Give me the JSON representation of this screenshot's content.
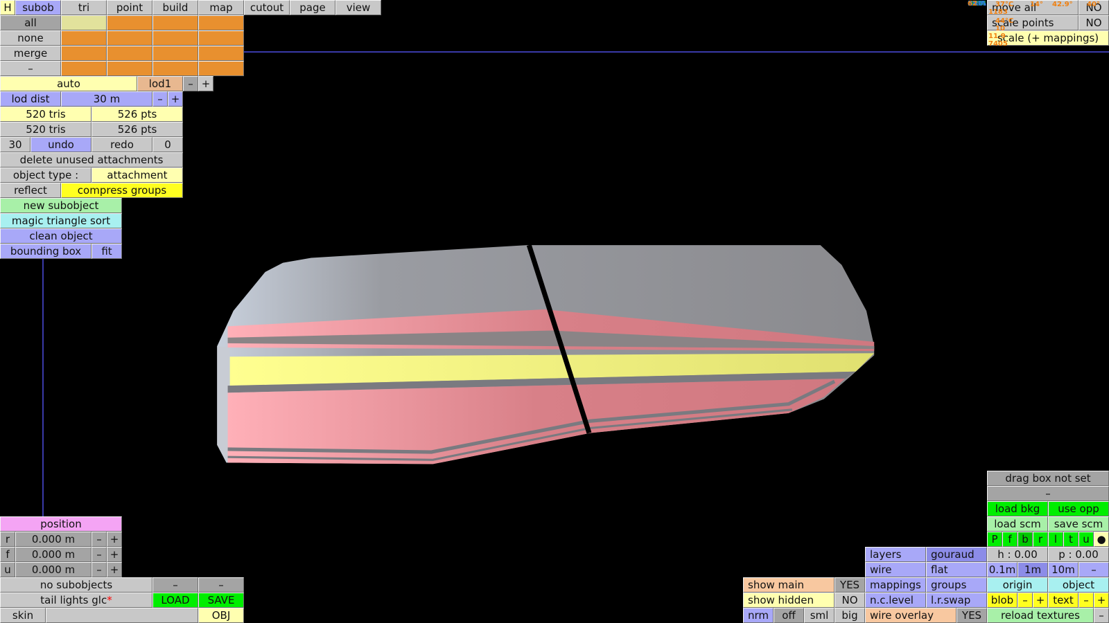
{
  "menu": {
    "h": "H",
    "tabs": [
      "subob",
      "tri",
      "point",
      "build",
      "map",
      "cutout",
      "page",
      "view"
    ]
  },
  "grid": {
    "rows": [
      "all",
      "none",
      "merge",
      "–"
    ]
  },
  "lod": {
    "auto": "auto",
    "level": "lod1",
    "minus": "–",
    "plus": "+",
    "dist_label": "lod dist",
    "dist_value": "30 m"
  },
  "stats": {
    "tris1": "520 tris",
    "pts1": "526 pts",
    "tris2": "520 tris",
    "pts2": "526 pts"
  },
  "undo": {
    "count": "30",
    "undo": "undo",
    "redo": "redo",
    "redo_count": "0"
  },
  "actions": {
    "delete_unused": "delete unused attachments",
    "object_type_label": "object type :",
    "object_type": "attachment",
    "reflect": "reflect",
    "compress": "compress groups",
    "new_subobject": "new subobject",
    "magic_sort": "magic triangle sort",
    "clean": "clean object",
    "bbox": "bounding box",
    "fit": "fit"
  },
  "position": {
    "title": "position",
    "axes": [
      {
        "axis": "r",
        "value": "0.000 m"
      },
      {
        "axis": "f",
        "value": "0.000 m"
      },
      {
        "axis": "u",
        "value": "0.000 m"
      }
    ],
    "minus": "–",
    "plus": "+"
  },
  "file": {
    "subobjects": "no subobjects",
    "dash": "–",
    "name": "tail lights glc",
    "modified": "*",
    "load": "LOAD",
    "save": "SAVE",
    "skin": "skin",
    "skin_value": "",
    "obj": "OBJ"
  },
  "topright": {
    "move_all": "move all",
    "move_all_val": "NO",
    "scale_points": "scale points",
    "scale_points_val": "NO",
    "scale_mappings": "scale (+ mappings)"
  },
  "monitor": {
    "labels": [
      "GPU",
      "MEM",
      "CPU₄",
      "CPU₁",
      "CPU",
      "RAM"
    ],
    "fps": "62",
    "gpu_temp": "37°C",
    "gpu_a": "14°",
    "gpu_b": "42.9°",
    "gpu_c": "40°",
    "mem": "1183",
    "cpu4": "44°C",
    "cpu1": "10",
    "cpu": "11.9",
    "ram": "7405"
  },
  "right": {
    "drag_box": "drag box not set",
    "dash": "–",
    "load_bkg": "load bkg",
    "use_opp": "use opp",
    "load_scm": "load scm",
    "save_scm": "save scm",
    "views": [
      "P",
      "f",
      "b",
      "r",
      "l",
      "t",
      "u",
      "●"
    ],
    "h": "h : 0.00",
    "p": "p : 0.00",
    "grid": [
      "0.1m",
      "1m",
      "10m",
      "–"
    ],
    "origin": "origin",
    "object": "object",
    "blob": "blob",
    "text": "text",
    "minus": "–",
    "plus": "+",
    "reload": "reload textures"
  },
  "display": {
    "layers": "layers",
    "gouraud": "gouraud",
    "wire": "wire",
    "flat": "flat",
    "mappings": "mappings",
    "groups": "groups",
    "ncl": "n.c.level",
    "lrswap": "l.r.swap",
    "wire_overlay": "wire overlay",
    "wire_overlay_val": "YES",
    "show_main": "show main",
    "show_main_val": "YES",
    "show_hidden": "show hidden",
    "show_hidden_val": "NO",
    "normals": [
      "nrm",
      "off",
      "sml",
      "big"
    ]
  }
}
